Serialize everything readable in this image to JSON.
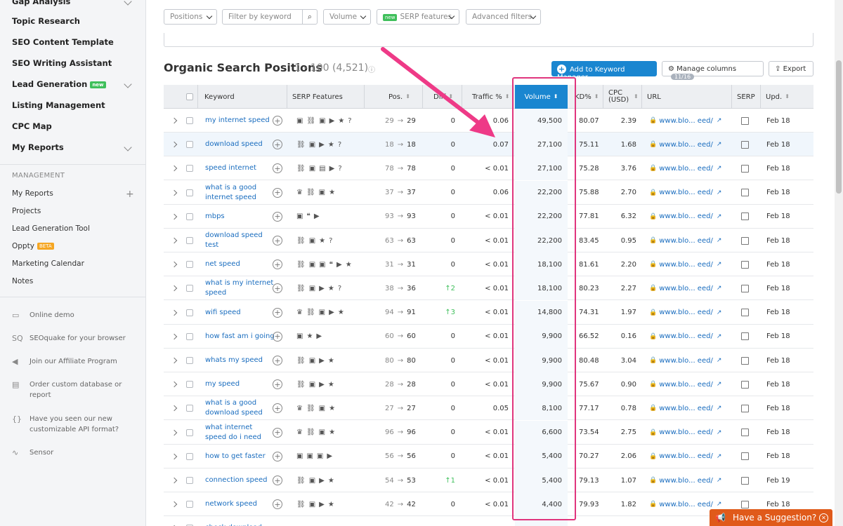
{
  "sidebar": {
    "top_items": [
      {
        "label": "Gap Analysis",
        "chevron": true
      },
      {
        "label": "Topic Research"
      },
      {
        "label": "SEO Content Template"
      },
      {
        "label": "SEO Writing Assistant"
      },
      {
        "label": "Lead Generation",
        "badge": "new",
        "chevron": true
      },
      {
        "label": "Listing Management"
      },
      {
        "label": "CPC Map"
      },
      {
        "label": "My Reports",
        "chevron": true
      }
    ],
    "management_heading": "MANAGEMENT",
    "management_items": [
      "My Reports",
      "Projects",
      "Lead Generation Tool",
      "Oppty",
      "Marketing Calendar",
      "Notes"
    ],
    "oppty_badge": "BETA",
    "extras": [
      {
        "icon": "monitor-icon",
        "label": "Online demo"
      },
      {
        "icon": "seoquake-icon",
        "label": "SEOquake for your browser"
      },
      {
        "icon": "megaphone-icon",
        "label": "Join our Affiliate Program"
      },
      {
        "icon": "document-icon",
        "label": "Order custom database or report"
      },
      {
        "icon": "braces-icon",
        "label": "Have you seen our new customizable API format?"
      },
      {
        "icon": "pulse-icon",
        "label": "Sensor"
      }
    ]
  },
  "filters": {
    "positions": "Positions",
    "keyword_placeholder": "Filter by keyword",
    "volume": "Volume",
    "serp_tag": "new",
    "serp": "SERP features",
    "advanced": "Advanced filters"
  },
  "report": {
    "title": "Organic Search Positions",
    "count": "1 - 100 (4,521)",
    "add_button": "Add to Keyword Manager",
    "manage_columns": "Manage columns",
    "columns_count": "11/16",
    "export": "Export"
  },
  "table": {
    "headers": {
      "keyword": "Keyword",
      "serp_features": "SERP Features",
      "pos": "Pos.",
      "diff": "Diff",
      "traffic": "Traffic %",
      "volume": "Volume",
      "kd": "KD%",
      "cpc": "CPC (USD)",
      "url": "URL",
      "serp": "SERP",
      "upd": "Upd."
    },
    "rows": [
      {
        "keyword": "my internet speed",
        "serp": [
          "▣",
          "⛓",
          "▣",
          "▶",
          "★",
          "?"
        ],
        "prev": "29",
        "pos": "29",
        "diff": "0",
        "traffic": "0.06",
        "volume": "49,500",
        "kd": "80.07",
        "cpc": "2.39",
        "url": "www.blo... eed/",
        "upd": "Feb 18"
      },
      {
        "keyword": "download speed",
        "serp": [
          "⛓",
          "▣",
          "▶",
          "★",
          "?"
        ],
        "prev": "18",
        "pos": "18",
        "diff": "0",
        "traffic": "0.07",
        "volume": "27,100",
        "kd": "75.11",
        "cpc": "1.68",
        "url": "www.blo... eed/",
        "upd": "Feb 18"
      },
      {
        "keyword": "speed internet",
        "serp": [
          "⛓",
          "▣",
          "▤",
          "▶",
          "?"
        ],
        "prev": "78",
        "pos": "78",
        "diff": "0",
        "traffic": "< 0.01",
        "volume": "27,100",
        "kd": "75.28",
        "cpc": "3.76",
        "url": "www.blo... eed/",
        "upd": "Feb 18"
      },
      {
        "keyword": "what is a good internet speed",
        "serp": [
          "♛",
          "⛓",
          "▣",
          "★"
        ],
        "prev": "37",
        "pos": "37",
        "diff": "0",
        "traffic": "0.06",
        "volume": "22,200",
        "kd": "75.88",
        "cpc": "2.70",
        "url": "www.blo... eed/",
        "upd": "Feb 18"
      },
      {
        "keyword": "mbps",
        "serp": [
          "▣",
          "❝",
          "▶"
        ],
        "prev": "93",
        "pos": "93",
        "diff": "0",
        "traffic": "< 0.01",
        "volume": "22,200",
        "kd": "77.81",
        "cpc": "6.32",
        "url": "www.blo... eed/",
        "upd": "Feb 18"
      },
      {
        "keyword": "download speed test",
        "serp": [
          "⛓",
          "▣",
          "★",
          "?"
        ],
        "prev": "63",
        "pos": "63",
        "diff": "0",
        "traffic": "< 0.01",
        "volume": "22,200",
        "kd": "83.45",
        "cpc": "0.95",
        "url": "www.blo... eed/",
        "upd": "Feb 18"
      },
      {
        "keyword": "net speed",
        "serp": [
          "⛓",
          "▣",
          "▣",
          "❝",
          "▶",
          "★"
        ],
        "prev": "31",
        "pos": "31",
        "diff": "0",
        "traffic": "< 0.01",
        "volume": "18,100",
        "kd": "81.61",
        "cpc": "2.20",
        "url": "www.blo... eed/",
        "upd": "Feb 18"
      },
      {
        "keyword": "what is my internet speed",
        "serp": [
          "⛓",
          "▣",
          "▶",
          "★",
          "?"
        ],
        "prev": "38",
        "pos": "36",
        "diff": "↑2",
        "traffic": "< 0.01",
        "volume": "18,100",
        "kd": "80.23",
        "cpc": "2.27",
        "url": "www.blo... eed/",
        "upd": "Feb 18"
      },
      {
        "keyword": "wifi speed",
        "serp": [
          "♛",
          "⛓",
          "▣",
          "▶",
          "★"
        ],
        "prev": "94",
        "pos": "91",
        "diff": "↑3",
        "traffic": "< 0.01",
        "volume": "14,800",
        "kd": "74.31",
        "cpc": "1.97",
        "url": "www.blo... eed/",
        "upd": "Feb 18"
      },
      {
        "keyword": "how fast am i going",
        "serp": [
          "▣",
          "★",
          "▶"
        ],
        "prev": "60",
        "pos": "60",
        "diff": "0",
        "traffic": "< 0.01",
        "volume": "9,900",
        "kd": "66.52",
        "cpc": "0.16",
        "url": "www.blo... eed/",
        "upd": "Feb 18"
      },
      {
        "keyword": "whats my speed",
        "serp": [
          "⛓",
          "▣",
          "▶",
          "★"
        ],
        "prev": "80",
        "pos": "80",
        "diff": "0",
        "traffic": "< 0.01",
        "volume": "9,900",
        "kd": "80.48",
        "cpc": "3.04",
        "url": "www.blo... eed/",
        "upd": "Feb 18"
      },
      {
        "keyword": "my speed",
        "serp": [
          "⛓",
          "▣",
          "▶",
          "★"
        ],
        "prev": "28",
        "pos": "28",
        "diff": "0",
        "traffic": "< 0.01",
        "volume": "9,900",
        "kd": "75.67",
        "cpc": "0.90",
        "url": "www.blo... eed/",
        "upd": "Feb 18"
      },
      {
        "keyword": "what is a good download speed",
        "serp": [
          "♛",
          "⛓",
          "▣",
          "★"
        ],
        "prev": "27",
        "pos": "27",
        "diff": "0",
        "traffic": "0.05",
        "volume": "8,100",
        "kd": "77.17",
        "cpc": "0.78",
        "url": "www.blo... eed/",
        "upd": "Feb 18"
      },
      {
        "keyword": "what internet speed do i need",
        "serp": [
          "♛",
          "⛓",
          "▣",
          "★"
        ],
        "prev": "96",
        "pos": "96",
        "diff": "0",
        "traffic": "< 0.01",
        "volume": "6,600",
        "kd": "73.54",
        "cpc": "2.75",
        "url": "www.blo... eed/",
        "upd": "Feb 18"
      },
      {
        "keyword": "how to get faster",
        "serp": [
          "▣",
          "▣",
          "▣",
          "▶"
        ],
        "prev": "56",
        "pos": "56",
        "diff": "0",
        "traffic": "< 0.01",
        "volume": "5,400",
        "kd": "70.27",
        "cpc": "2.06",
        "url": "www.blo... eed/",
        "upd": "Feb 18"
      },
      {
        "keyword": "connection speed",
        "serp": [
          "⛓",
          "▣",
          "▶",
          "★"
        ],
        "prev": "54",
        "pos": "53",
        "diff": "↑1",
        "traffic": "< 0.01",
        "volume": "5,400",
        "kd": "79.13",
        "cpc": "1.07",
        "url": "www.blo... eed/",
        "upd": "Feb 19"
      },
      {
        "keyword": "network speed",
        "serp": [
          "⛓",
          "▣",
          "▶",
          "★"
        ],
        "prev": "42",
        "pos": "42",
        "diff": "0",
        "traffic": "< 0.01",
        "volume": "4,400",
        "kd": "79.93",
        "cpc": "1.82",
        "url": "www.blo... eed/",
        "upd": "Feb 18"
      },
      {
        "keyword": "check download",
        "serp": [],
        "prev": "",
        "pos": "",
        "diff": "",
        "traffic": "",
        "volume": "",
        "kd": "",
        "cpc": "",
        "url": "",
        "upd": ""
      }
    ]
  },
  "suggestion": {
    "label": "Have a Suggestion?"
  },
  "colors": {
    "accent": "#1a86d0",
    "highlight": "#e0357d",
    "suggest": "#e05a1a",
    "up": "#3fbf5b"
  }
}
